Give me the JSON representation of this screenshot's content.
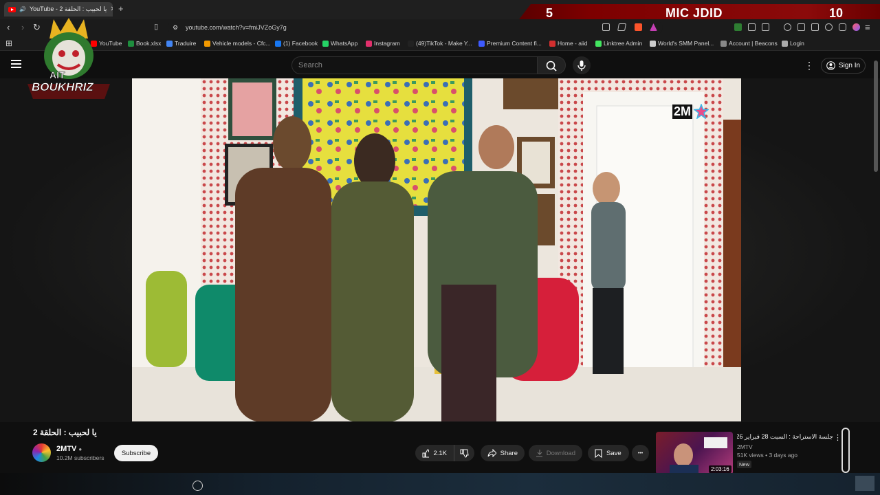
{
  "browser": {
    "tab_title": "YouTube - 2 يا لحبيب : الحلقة",
    "new_tab": "+",
    "url": "youtube.com/watch?v=fmiJVZoGy7g",
    "bookmarks": [
      {
        "label": "YouTube",
        "color": "#ff0000"
      },
      {
        "label": "Book.xlsx",
        "color": "#1e8e3e"
      },
      {
        "label": "Traduire",
        "color": "#4285f4"
      },
      {
        "label": "Vehicle models - Cfc...",
        "color": "#f29900"
      },
      {
        "label": "(1) Facebook",
        "color": "#1877f2"
      },
      {
        "label": "WhatsApp",
        "color": "#25d366"
      },
      {
        "label": "Instagram",
        "color": "#e1306c"
      },
      {
        "label": "(49)TikTok - Make Y...",
        "color": "#222222"
      },
      {
        "label": "Premium Content fi...",
        "color": "#3d5afe"
      },
      {
        "label": "Home - aiid",
        "color": "#d32f2f"
      },
      {
        "label": "Linktree Admin",
        "color": "#43e660"
      },
      {
        "label": "World's SMM Panel...",
        "color": "#cccccc"
      },
      {
        "label": "Account | Beacons",
        "color": "#888888"
      },
      {
        "label": "Login",
        "color": "#aaaaaa"
      }
    ]
  },
  "overlay": {
    "banner_number": "5",
    "banner_title": "MIC JDID",
    "banner_right": "10",
    "logo_line1": "AIT",
    "logo_line2": "BOUKHRIZ"
  },
  "youtube": {
    "search_placeholder": "Search",
    "sign_in": "Sign In",
    "channel_watermark": "2M"
  },
  "video": {
    "title": "يا لحبيب : الحلقة 2",
    "channel": "2MTV",
    "subscribers": "10.2M subscribers",
    "subscribe_label": "Subscribe",
    "likes": "2.1K",
    "share_label": "Share",
    "download_label": "Download",
    "save_label": "Save",
    "more_label": "•••"
  },
  "recommendation": {
    "title": "جلسة الاستراحة : السبت 28 فبراير 2026",
    "channel": "2MTV",
    "meta": "51K views • 3 days ago",
    "badge": "New",
    "duration": "2:03:16"
  }
}
